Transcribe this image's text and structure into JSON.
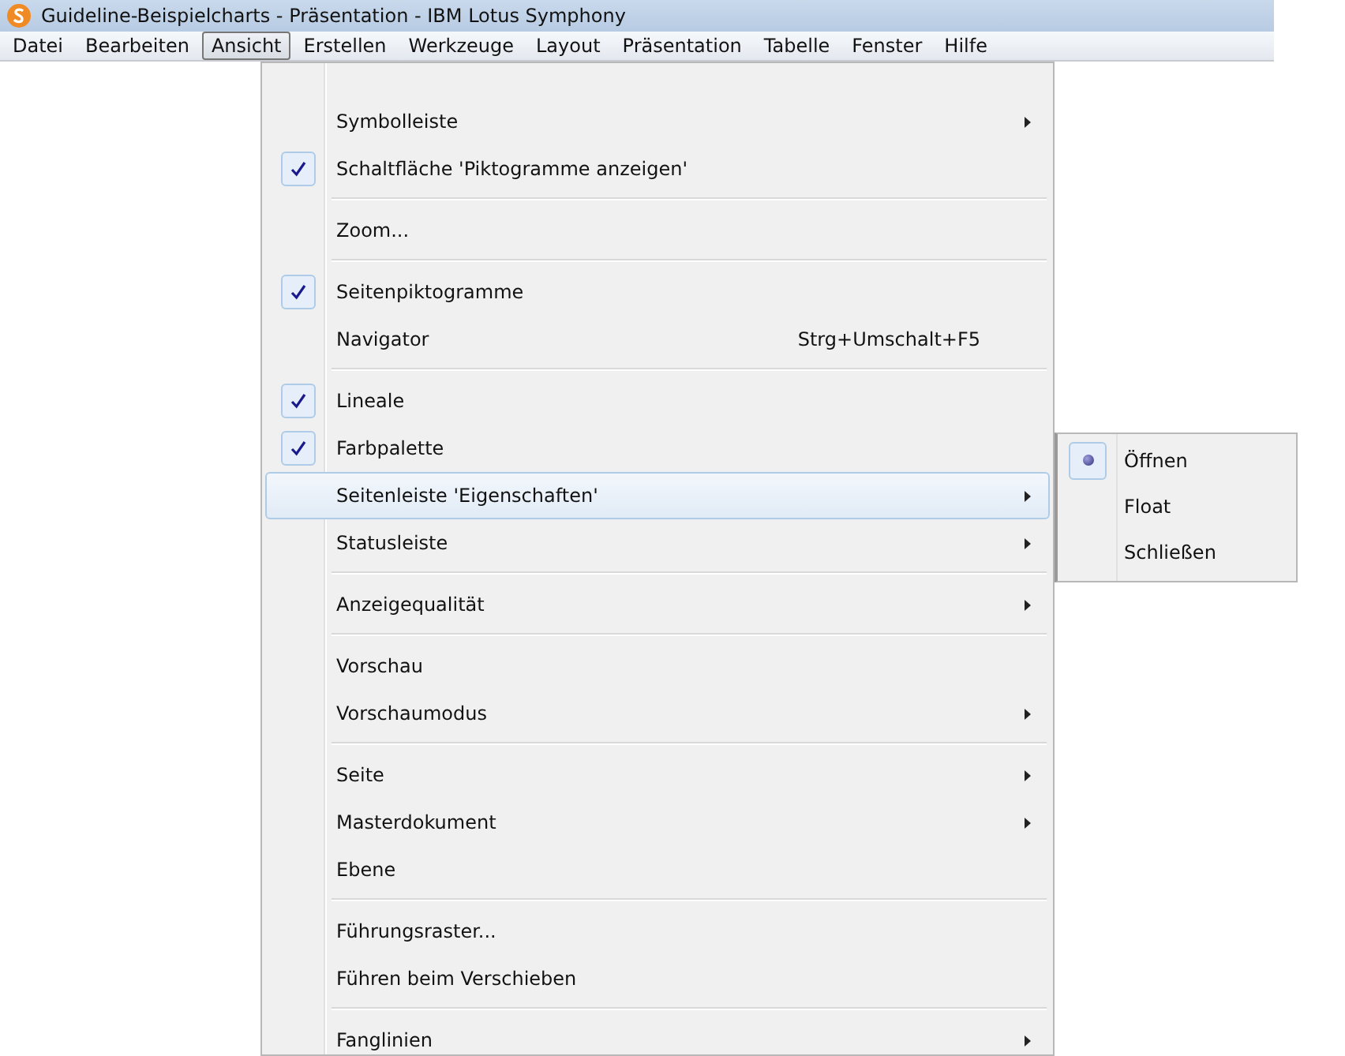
{
  "window": {
    "title": "Guideline-Beispielcharts - Präsentation - IBM Lotus Symphony"
  },
  "menubar": [
    {
      "label": "Datei",
      "selected": false
    },
    {
      "label": "Bearbeiten",
      "selected": false
    },
    {
      "label": "Ansicht",
      "selected": true
    },
    {
      "label": "Erstellen",
      "selected": false
    },
    {
      "label": "Werkzeuge",
      "selected": false
    },
    {
      "label": "Layout",
      "selected": false
    },
    {
      "label": "Präsentation",
      "selected": false
    },
    {
      "label": "Tabelle",
      "selected": false
    },
    {
      "label": "Fenster",
      "selected": false
    },
    {
      "label": "Hilfe",
      "selected": false
    }
  ],
  "menu": [
    {
      "kind": "item",
      "label": "Symbolleiste",
      "checked": false,
      "submenu": true,
      "selected": false
    },
    {
      "kind": "item",
      "label": "Schaltfläche 'Piktogramme anzeigen'",
      "checked": true,
      "submenu": false,
      "selected": false
    },
    {
      "kind": "separator"
    },
    {
      "kind": "item",
      "label": "Zoom...",
      "checked": false,
      "submenu": false,
      "selected": false
    },
    {
      "kind": "separator"
    },
    {
      "kind": "item",
      "label": "Seitenpiktogramme",
      "checked": true,
      "submenu": false,
      "selected": false
    },
    {
      "kind": "item",
      "label": "Navigator",
      "shortcut": "Strg+Umschalt+F5",
      "checked": false,
      "submenu": false,
      "selected": false
    },
    {
      "kind": "separator"
    },
    {
      "kind": "item",
      "label": "Lineale",
      "checked": true,
      "submenu": false,
      "selected": false
    },
    {
      "kind": "item",
      "label": "Farbpalette",
      "checked": true,
      "submenu": false,
      "selected": false
    },
    {
      "kind": "item",
      "label": "Seitenleiste 'Eigenschaften'",
      "checked": false,
      "submenu": true,
      "selected": true
    },
    {
      "kind": "item",
      "label": "Statusleiste",
      "checked": false,
      "submenu": true,
      "selected": false
    },
    {
      "kind": "separator"
    },
    {
      "kind": "item",
      "label": "Anzeigequalität",
      "checked": false,
      "submenu": true,
      "selected": false
    },
    {
      "kind": "separator"
    },
    {
      "kind": "item",
      "label": "Vorschau",
      "checked": false,
      "submenu": false,
      "selected": false
    },
    {
      "kind": "item",
      "label": "Vorschaumodus",
      "checked": false,
      "submenu": true,
      "selected": false
    },
    {
      "kind": "separator"
    },
    {
      "kind": "item",
      "label": "Seite",
      "checked": false,
      "submenu": true,
      "selected": false
    },
    {
      "kind": "item",
      "label": "Masterdokument",
      "checked": false,
      "submenu": true,
      "selected": false
    },
    {
      "kind": "item",
      "label": "Ebene",
      "checked": false,
      "submenu": false,
      "selected": false
    },
    {
      "kind": "separator"
    },
    {
      "kind": "item",
      "label": "Führungsraster...",
      "checked": false,
      "submenu": false,
      "selected": false
    },
    {
      "kind": "item",
      "label": "Führen beim Verschieben",
      "checked": false,
      "submenu": false,
      "selected": false
    },
    {
      "kind": "separator"
    },
    {
      "kind": "item",
      "label": "Fanglinien",
      "checked": false,
      "submenu": true,
      "selected": false
    }
  ],
  "submenu": [
    {
      "label": "Öffnen",
      "selected": true
    },
    {
      "label": "Float",
      "selected": false
    },
    {
      "label": "Schließen",
      "selected": false
    }
  ]
}
